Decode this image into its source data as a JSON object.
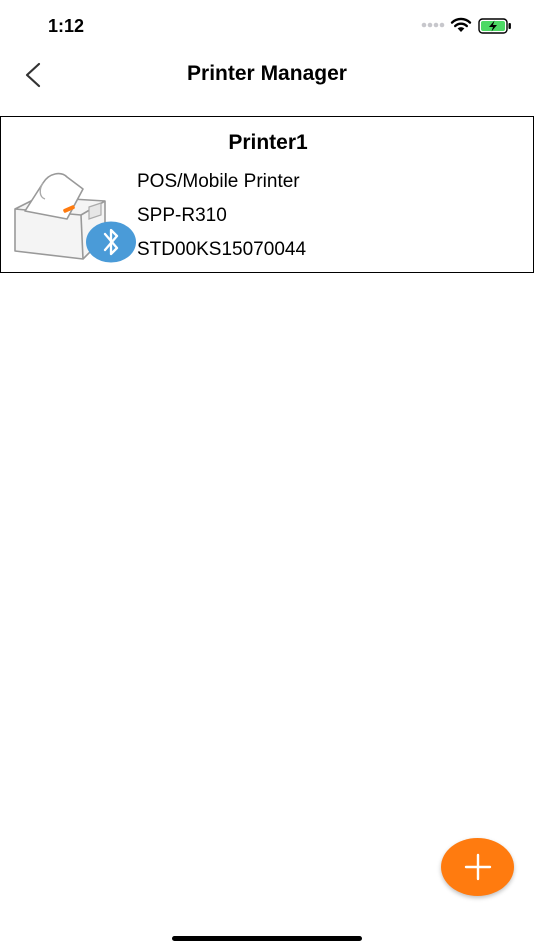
{
  "status_bar": {
    "time": "1:12",
    "icons": [
      "signal-dots-icon",
      "wifi-icon",
      "battery-charging-icon"
    ],
    "battery_color": "#4cd964"
  },
  "nav": {
    "title": "Printer Manager",
    "back_icon": "chevron-left-icon"
  },
  "printers": [
    {
      "name": "Printer1",
      "type": "POS/Mobile Printer",
      "model": "SPP-R310",
      "serial": "STD00KS15070044",
      "icon": "bluetooth-icon",
      "icon_color": "#4a9bd8"
    }
  ],
  "fab": {
    "icon": "plus-icon",
    "color": "#ff7b0f"
  }
}
